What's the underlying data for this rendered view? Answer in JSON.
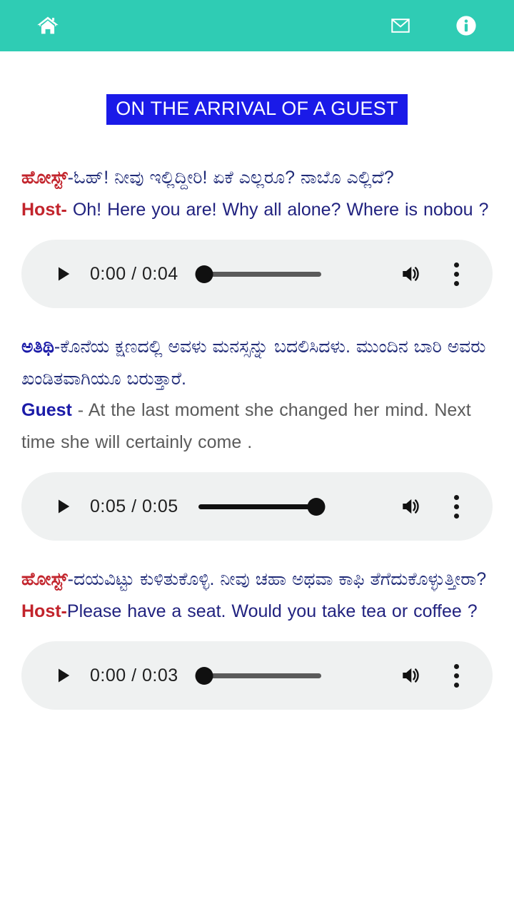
{
  "header": {
    "home_icon": "home-icon",
    "mail_icon": "envelope-icon",
    "info_icon": "info-icon",
    "background_color": "#2FCCB4"
  },
  "title": {
    "text": "ON THE ARRIVAL OF A GUEST",
    "background_color": "#1A1AE8",
    "text_color": "#FFFFFF"
  },
  "colors": {
    "speaker_red": "#C2242C",
    "speaker_blue": "#1B1BA8",
    "body_blue": "#21227F",
    "body_gray": "#5B5B5B",
    "player_bg": "#EFF1F1"
  },
  "dialogues": [
    {
      "kannada_speaker": "ಹೋಸ್ಟ್",
      "kannada_speaker_color": "red",
      "kannada_text": "-ಓಹ್! ನೀವು ಇಲ್ಲಿದ್ದೀರಿ! ಏಕೆ ಎಲ್ಲರೂ? ನಾಬೊ ಎಲ್ಲಿದೆ?",
      "english_speaker": "Host-",
      "english_speaker_color": "red",
      "english_text": " Oh! Here you are! Why all alone? Where is nobou ?",
      "english_text_color": "blue",
      "player": {
        "play_label": "play-icon",
        "time": "0:00 / 0:04",
        "current_time": "0:00",
        "duration": "0:04",
        "progress_percent": 0,
        "volume_icon": "volume-icon",
        "menu_icon": "more-vertical-icon"
      }
    },
    {
      "kannada_speaker": "ಅತಿಥಿ",
      "kannada_speaker_color": "blue",
      "kannada_text": "-ಕೊನೆಯ ಕ್ಷಣದಲ್ಲಿ ಅವಳು ಮನಸ್ಸನ್ನು ಬದಲಿಸಿದಳು. ಮುಂದಿನ ಬಾರಿ ಅವರು ಖಂಡಿತವಾಗಿಯೂ ಬರುತ್ತಾರೆ.",
      "english_speaker": "Guest ",
      "english_speaker_color": "blue",
      "english_text": "- At the last moment she changed her mind. Next time she will certainly come .",
      "english_text_color": "gray",
      "player": {
        "play_label": "play-icon",
        "time": "0:05 / 0:05",
        "current_time": "0:05",
        "duration": "0:05",
        "progress_percent": 100,
        "volume_icon": "volume-icon",
        "menu_icon": "more-vertical-icon"
      }
    },
    {
      "kannada_speaker": "ಹೋಸ್ಟ್",
      "kannada_speaker_color": "red",
      "kannada_text": "-ದಯವಿಟ್ಟು ಕುಳಿತುಕೊಳ್ಳಿ. ನೀವು ಚಹಾ ಅಥವಾ ಕಾಫಿ ತೆಗೆದುಕೊಳ್ಳುತ್ತೀರಾ?",
      "english_speaker": "Host-",
      "english_speaker_color": "red",
      "english_text": "Please have a seat. Would you take tea or coffee ?",
      "english_text_color": "blue",
      "player": {
        "play_label": "play-icon",
        "time": "0:00 / 0:03",
        "current_time": "0:00",
        "duration": "0:03",
        "progress_percent": 0,
        "volume_icon": "volume-icon",
        "menu_icon": "more-vertical-icon"
      }
    }
  ]
}
